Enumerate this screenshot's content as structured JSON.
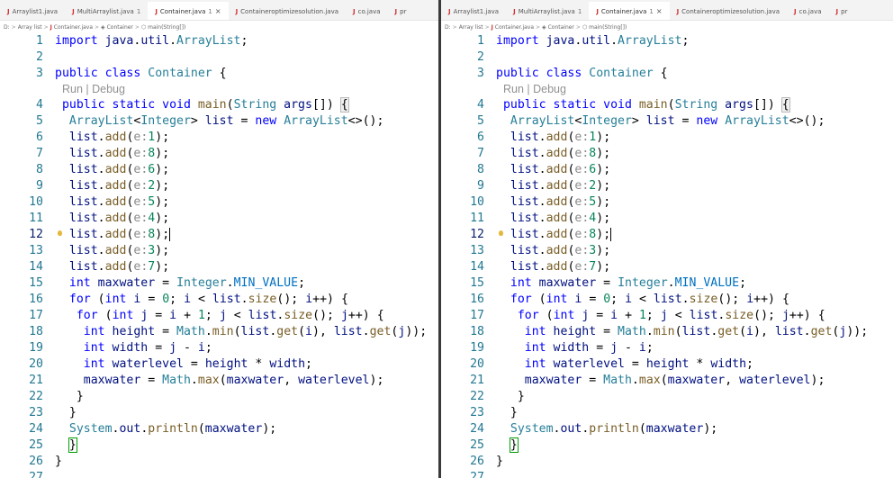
{
  "left_pane": {
    "tabs": [
      {
        "label": "Arraylist1.java",
        "active": false,
        "modified": ""
      },
      {
        "label": "MultiArraylist.java",
        "active": false,
        "modified": "1"
      },
      {
        "label": "Container.java",
        "active": true,
        "modified": "1"
      },
      {
        "label": "Containeroptimizesolution.java",
        "active": false,
        "modified": ""
      },
      {
        "label": "co.java",
        "active": false,
        "modified": ""
      },
      {
        "label": "pr",
        "active": false,
        "modified": ""
      }
    ],
    "breadcrumb": [
      "D:",
      "Array list",
      "Container.java",
      "Container",
      "main(String[])"
    ]
  },
  "right_pane": {
    "tabs": [
      {
        "label": "Arraylist1.java",
        "active": false,
        "modified": ""
      },
      {
        "label": "MultiArraylist.java",
        "active": false,
        "modified": "1"
      },
      {
        "label": "Container.java",
        "active": true,
        "modified": "1"
      },
      {
        "label": "Containeroptimizesolution.java",
        "active": false,
        "modified": ""
      },
      {
        "label": "co.java",
        "active": false,
        "modified": ""
      },
      {
        "label": "pr",
        "active": false,
        "modified": ""
      }
    ],
    "breadcrumb": [
      "D:",
      "Array list",
      "Container.java",
      "Container",
      "main(String[])"
    ]
  },
  "tab_close_icon": "×",
  "tab_file_icon": "J",
  "codelens": "Run | Debug",
  "current_line": 12,
  "code_lines": [
    {
      "n": "1"
    },
    {
      "n": "2"
    },
    {
      "n": "3"
    },
    {
      "n": "4"
    },
    {
      "n": "5"
    },
    {
      "n": "6"
    },
    {
      "n": "7"
    },
    {
      "n": "8"
    },
    {
      "n": "9"
    },
    {
      "n": "10"
    },
    {
      "n": "11"
    },
    {
      "n": "12"
    },
    {
      "n": "13"
    },
    {
      "n": "14"
    },
    {
      "n": "15"
    },
    {
      "n": "16"
    },
    {
      "n": "17"
    },
    {
      "n": "18"
    },
    {
      "n": "19"
    },
    {
      "n": "20"
    },
    {
      "n": "21"
    },
    {
      "n": "22"
    },
    {
      "n": "23"
    },
    {
      "n": "24"
    },
    {
      "n": "25"
    },
    {
      "n": "26"
    },
    {
      "n": "27"
    }
  ],
  "code_text": {
    "import_line": "import java.util.ArrayList;",
    "class_decl": "public class Container {",
    "main_decl": "public static void main(String args[]) {",
    "list_decl": "ArrayList<Integer> list = new ArrayList<>();",
    "adds": [
      "1",
      "8",
      "6",
      "2",
      "5",
      "4",
      "8",
      "3",
      "7"
    ],
    "add_prefix": "list.add(",
    "add_hint": "e:",
    "add_suffix": ");",
    "maxwater_decl": "int maxwater = Integer.MIN_VALUE;",
    "for_i": "for (int i = 0; i < list.size(); i++) {",
    "for_j": "for (int j = i + 1; j < list.size(); j++) {",
    "height_line": "int height = Math.min(list.get(i), list.get(j));",
    "width_line": "int width = j - i;",
    "waterlevel_line": "int waterlevel = height * width;",
    "maxwater_update": "maxwater = Math.max(maxwater, waterlevel);",
    "close_brace": "}",
    "println_line": "System.out.println(maxwater);"
  },
  "colors": {
    "keyword": "#0000ff",
    "type": "#267f99",
    "function": "#795e26",
    "number": "#098658",
    "line_number": "#237893",
    "lightbulb": "#e2b93d"
  }
}
